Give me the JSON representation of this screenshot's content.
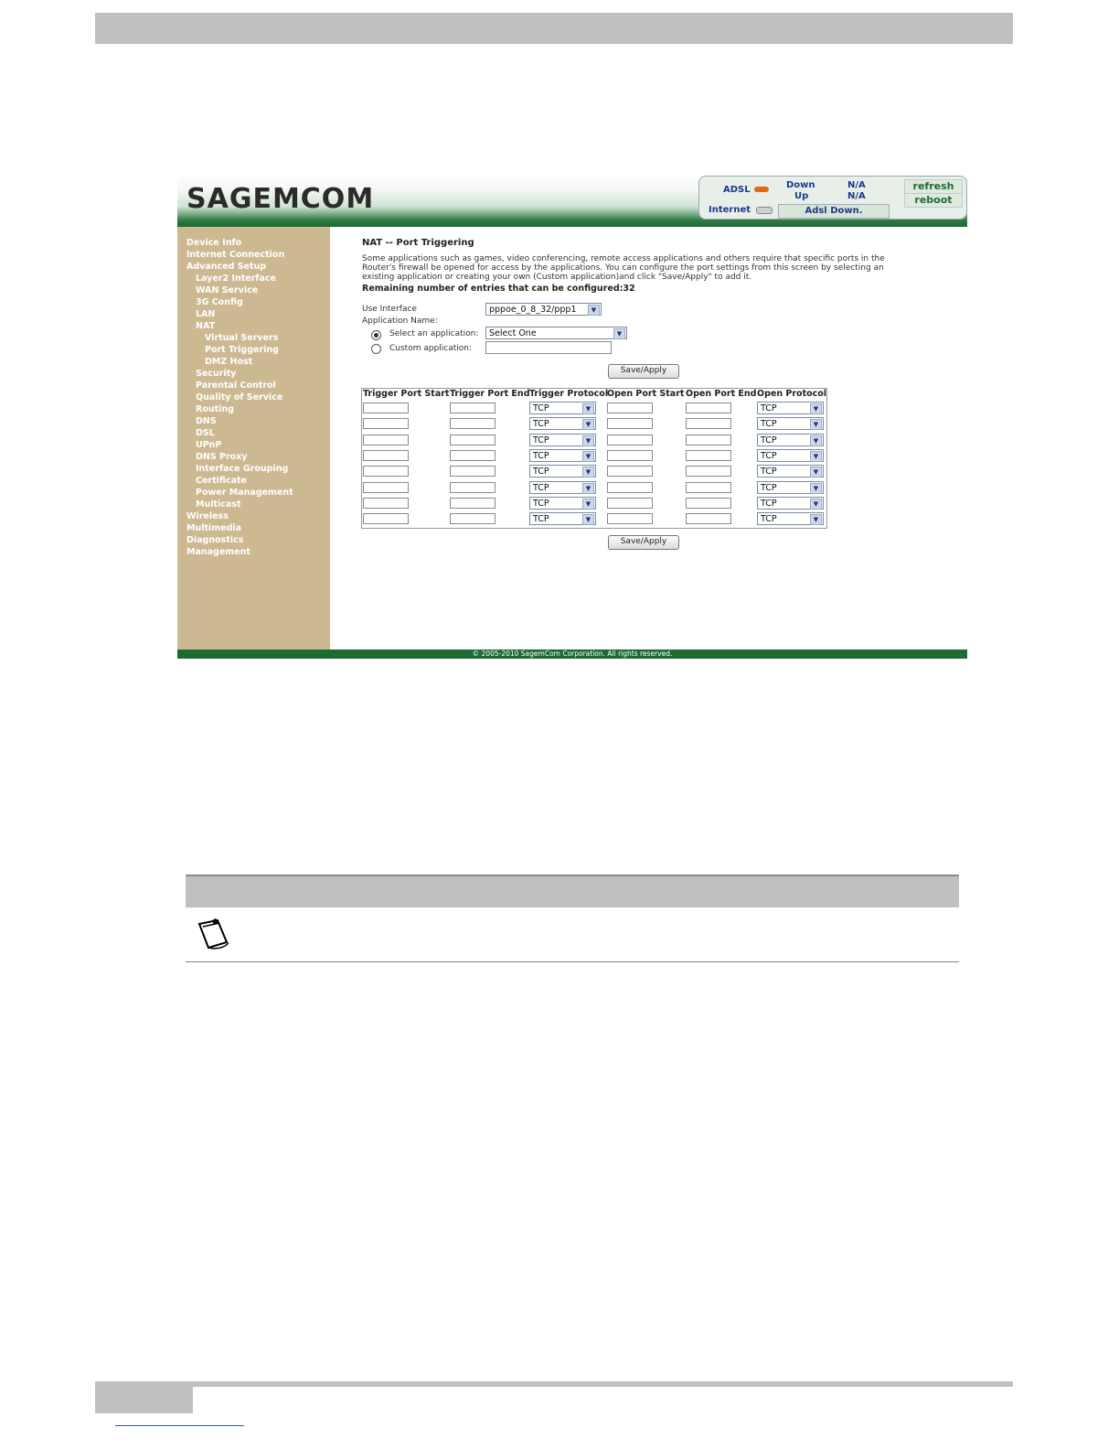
{
  "brand": "SAGEMCOM",
  "status": {
    "adsl_label": "ADSL",
    "down_label": "Down",
    "up_label": "Up",
    "down_value": "N/A",
    "up_value": "N/A",
    "internet_label": "Internet",
    "adsl_state": "Adsl Down.",
    "refresh": "refresh",
    "reboot": "reboot",
    "adsl_led_color": "#e06a10",
    "internet_led_color": "#cfcfcf"
  },
  "sidebar": {
    "items": [
      {
        "label": "Device Info",
        "level": 0
      },
      {
        "label": "Internet Connection",
        "level": 0
      },
      {
        "label": "Advanced Setup",
        "level": 0
      },
      {
        "label": "Layer2 Interface",
        "level": 1
      },
      {
        "label": "WAN Service",
        "level": 1
      },
      {
        "label": "3G Config",
        "level": 1
      },
      {
        "label": "LAN",
        "level": 1
      },
      {
        "label": "NAT",
        "level": 1
      },
      {
        "label": "Virtual Servers",
        "level": 2
      },
      {
        "label": "Port Triggering",
        "level": 2
      },
      {
        "label": "DMZ Host",
        "level": 2
      },
      {
        "label": "Security",
        "level": 1
      },
      {
        "label": "Parental Control",
        "level": 1
      },
      {
        "label": "Quality of Service",
        "level": 1
      },
      {
        "label": "Routing",
        "level": 1
      },
      {
        "label": "DNS",
        "level": 1
      },
      {
        "label": "DSL",
        "level": 1
      },
      {
        "label": "UPnP",
        "level": 1
      },
      {
        "label": "DNS Proxy",
        "level": 1
      },
      {
        "label": "Interface Grouping",
        "level": 1
      },
      {
        "label": "Certificate",
        "level": 1
      },
      {
        "label": "Power Management",
        "level": 1
      },
      {
        "label": "Multicast",
        "level": 1
      },
      {
        "label": "Wireless",
        "level": 0
      },
      {
        "label": "Multimedia",
        "level": 0
      },
      {
        "label": "Diagnostics",
        "level": 0
      },
      {
        "label": "Management",
        "level": 0
      }
    ]
  },
  "main": {
    "title": "NAT -- Port Triggering",
    "description": "Some applications such as games, video conferencing, remote access applications and others require that specific ports in the Router's firewall be opened for access by the applications. You can configure the port settings from this screen by selecting an existing application or creating your own (Custom application)and click \"Save/Apply\" to add it.",
    "remaining": "Remaining number of entries that can be configured:32",
    "use_interface_label": "Use Interface",
    "use_interface_value": "pppoe_0_8_32/ppp1",
    "application_name_label": "Application Name:",
    "select_app_label": "Select an application:",
    "select_app_value": "Select One",
    "custom_app_label": "Custom application:",
    "custom_app_value": "",
    "save_apply": "Save/Apply"
  },
  "table": {
    "headers": [
      "Trigger Port Start",
      "Trigger Port End",
      "Trigger Protocol",
      "Open Port Start",
      "Open Port End",
      "Open Protocol"
    ],
    "rows": [
      {
        "trigger_protocol": "TCP",
        "open_protocol": "TCP"
      },
      {
        "trigger_protocol": "TCP",
        "open_protocol": "TCP"
      },
      {
        "trigger_protocol": "TCP",
        "open_protocol": "TCP"
      },
      {
        "trigger_protocol": "TCP",
        "open_protocol": "TCP"
      },
      {
        "trigger_protocol": "TCP",
        "open_protocol": "TCP"
      },
      {
        "trigger_protocol": "TCP",
        "open_protocol": "TCP"
      },
      {
        "trigger_protocol": "TCP",
        "open_protocol": "TCP"
      },
      {
        "trigger_protocol": "TCP",
        "open_protocol": "TCP"
      }
    ]
  },
  "footer": "© 2005-2010 SagemCom Corporation. All rights reserved.",
  "note_icon": "notepad-icon"
}
